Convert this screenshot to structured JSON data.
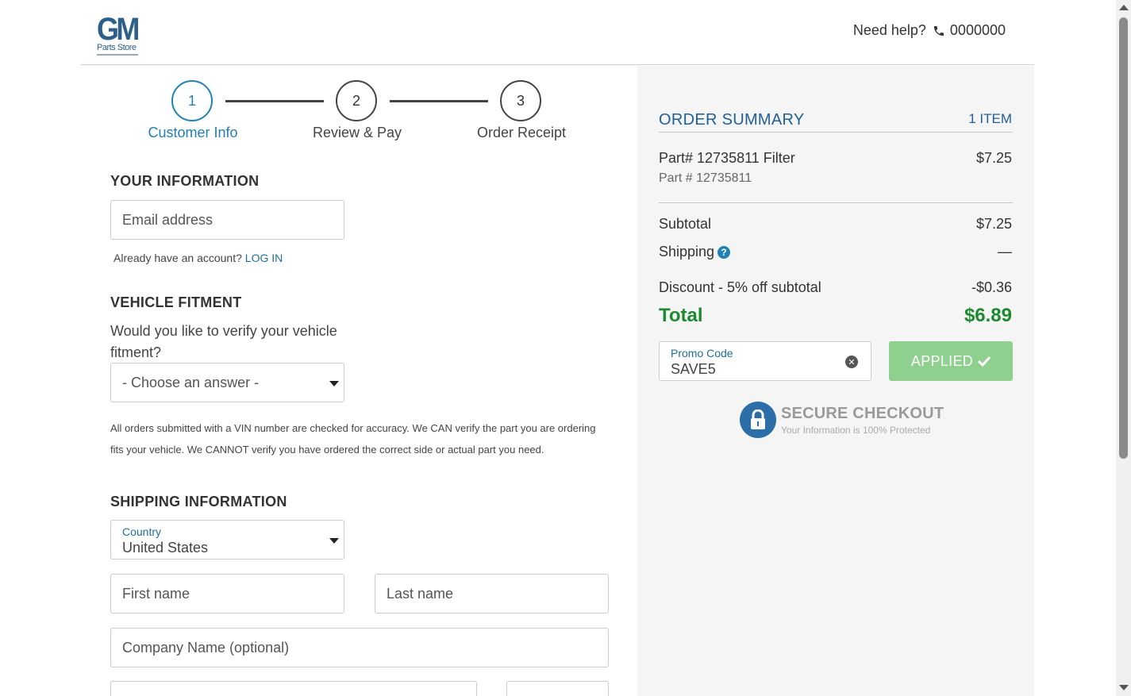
{
  "header": {
    "logo_main": "GM",
    "logo_sub": "Parts Store",
    "help_text": "Need help?",
    "phone": "0000000"
  },
  "steps": [
    {
      "number": "1",
      "label": "Customer Info"
    },
    {
      "number": "2",
      "label": "Review & Pay"
    },
    {
      "number": "3",
      "label": "Order Receipt"
    }
  ],
  "your_info": {
    "title": "YOUR INFORMATION",
    "email_placeholder": "Email address",
    "account_prompt": "Already have an account?",
    "login_link": "LOG IN"
  },
  "fitment": {
    "title": "VEHICLE FITMENT",
    "question": "Would you like to verify your vehicle fitment?",
    "select_value": "- Choose an answer -",
    "note": "All orders submitted with a VIN number are checked for accuracy. We CAN verify the part you are ordering fits your vehicle. We CANNOT verify you have ordered the correct side or actual part you need."
  },
  "shipping": {
    "title": "SHIPPING INFORMATION",
    "country_label": "Country",
    "country_value": "United States",
    "first_name_placeholder": "First name",
    "last_name_placeholder": "Last name",
    "company_placeholder": "Company Name (optional)"
  },
  "summary": {
    "title": "ORDER SUMMARY",
    "item_count": "1 ITEM",
    "item_name": "Part# 12735811 Filter",
    "item_price": "$7.25",
    "item_part": "Part # 12735811",
    "subtotal_label": "Subtotal",
    "subtotal_value": "$7.25",
    "shipping_label": "Shipping",
    "shipping_value": "—",
    "discount_label": "Discount - 5% off subtotal",
    "discount_value": "-$0.36",
    "total_label": "Total",
    "total_value": "$6.89",
    "promo_label": "Promo Code",
    "promo_value": "SAVE5",
    "applied_label": "APPLIED",
    "secure_title": "SECURE CHECKOUT",
    "secure_sub": "Your Information is 100% Protected"
  },
  "colors": {
    "accent_blue": "#2180b5",
    "total_green": "#1c8a2e",
    "applied_green": "#8fd08e"
  }
}
